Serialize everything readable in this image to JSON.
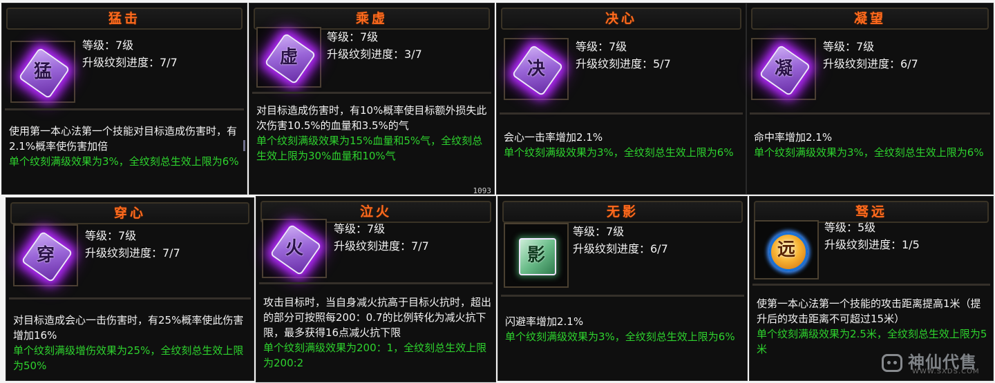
{
  "cards": [
    {
      "title": "猛击",
      "glyph": "猛",
      "level": "等级：7级",
      "progress": "升级纹刻进度：7/7",
      "desc_white": "使用第一本心法第一个技能对目标造成伤害时，有2.1%概率使伤害加倍",
      "desc_green": "单个纹刻满级效果为3%，全纹刻总生效上限为6%"
    },
    {
      "title": "乘虚",
      "glyph": "虚",
      "level": "等级：7级",
      "progress": "升级纹刻进度：3/7",
      "desc_white": "对目标造成伤害时，有10%概率使目标额外损失此次伤害10.5%的血量和3.5%的气",
      "desc_green": "单个纹刻满级效果为15%血量和5%气，全纹刻总生效上限为30%血量和10%气"
    },
    {
      "title": "决心",
      "glyph": "决",
      "level": "等级：7级",
      "progress": "升级纹刻进度：5/7",
      "desc_white": "会心一击率增加2.1%",
      "desc_green": "单个纹刻满级效果为3%，全纹刻总生效上限为6%"
    },
    {
      "title": "凝望",
      "glyph": "凝",
      "level": "等级：7级",
      "progress": "升级纹刻进度：6/7",
      "desc_white": "命中率增加2.1%",
      "desc_green": "单个纹刻满级效果为3%，全纹刻总生效上限为6%"
    },
    {
      "title": "穿心",
      "glyph": "穿",
      "level": "等级：7级",
      "progress": "升级纹刻进度：7/7",
      "desc_white": "对目标造成会心一击伤害时，有25%概率使此伤害增加16%",
      "desc_green": "单个纹刻满级增伤效果为25%，全纹刻总生效上限为50%"
    },
    {
      "title": "泣火",
      "glyph": "火",
      "level": "等级：7级",
      "progress": "升级纹刻进度：7/7",
      "desc_white": "攻击目标时，当自身减火抗高于目标火抗时，超出的部分可按照每200：0.7的比例转化为减火抗下限，最多获得16点减火抗下限",
      "desc_green": "单个纹刻满级效果为200：1，全纹刻总生效上限为200:2"
    },
    {
      "title": "无影",
      "glyph": "影",
      "level": "等级：7级",
      "progress": "升级纹刻进度：6/7",
      "desc_white": "闪避率增加2.1%",
      "desc_green": "单个纹刻满级效果为3%，全纹刻总生效上限为6%"
    },
    {
      "title": "驽远",
      "glyph": "远",
      "level": "等级：5级",
      "progress": "升级纹刻进度：1/5",
      "desc_white": "使第一本心法第一个技能的攻击距离提高1米（提升后的攻击距离不可超过15米）",
      "desc_green": "单个纹刻满级效果为2.5米，全纹刻总生效上限为5米"
    }
  ],
  "stray_text": "1093",
  "watermark": {
    "text": "神仙代售",
    "url": "WWW.SXDS.COM"
  },
  "colors": {
    "title": "#ff6a1e",
    "green_text": "#2ed32e",
    "glow": "#b52bff"
  }
}
